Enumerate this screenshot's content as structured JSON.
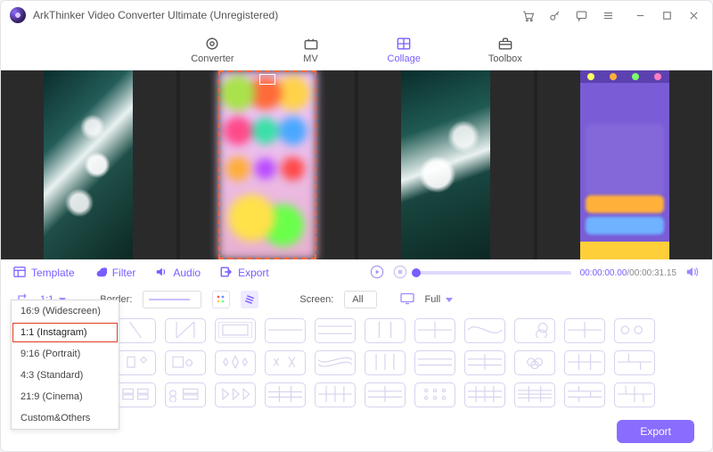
{
  "title": "ArkThinker Video Converter Ultimate (Unregistered)",
  "nav": {
    "converter": "Converter",
    "mv": "MV",
    "collage": "Collage",
    "toolbox": "Toolbox",
    "active": "collage"
  },
  "subtools": {
    "template": "Template",
    "filter": "Filter",
    "audio": "Audio",
    "export": "Export"
  },
  "playback": {
    "current": "00:00:00.00",
    "duration": "00:00:31.15"
  },
  "options": {
    "ratio_selected": "1:1",
    "border_label": "Border:",
    "screen_label": "Screen:",
    "screen_value": "All",
    "full_value": "Full"
  },
  "ratio_menu": [
    "16:9 (Widescreen)",
    "1:1 (Instagram)",
    "9:16 (Portrait)",
    "4:3 (Standard)",
    "21:9 (Cinema)",
    "Custom&Others"
  ],
  "ratio_menu_highlight_index": 1,
  "export_button": "Export"
}
